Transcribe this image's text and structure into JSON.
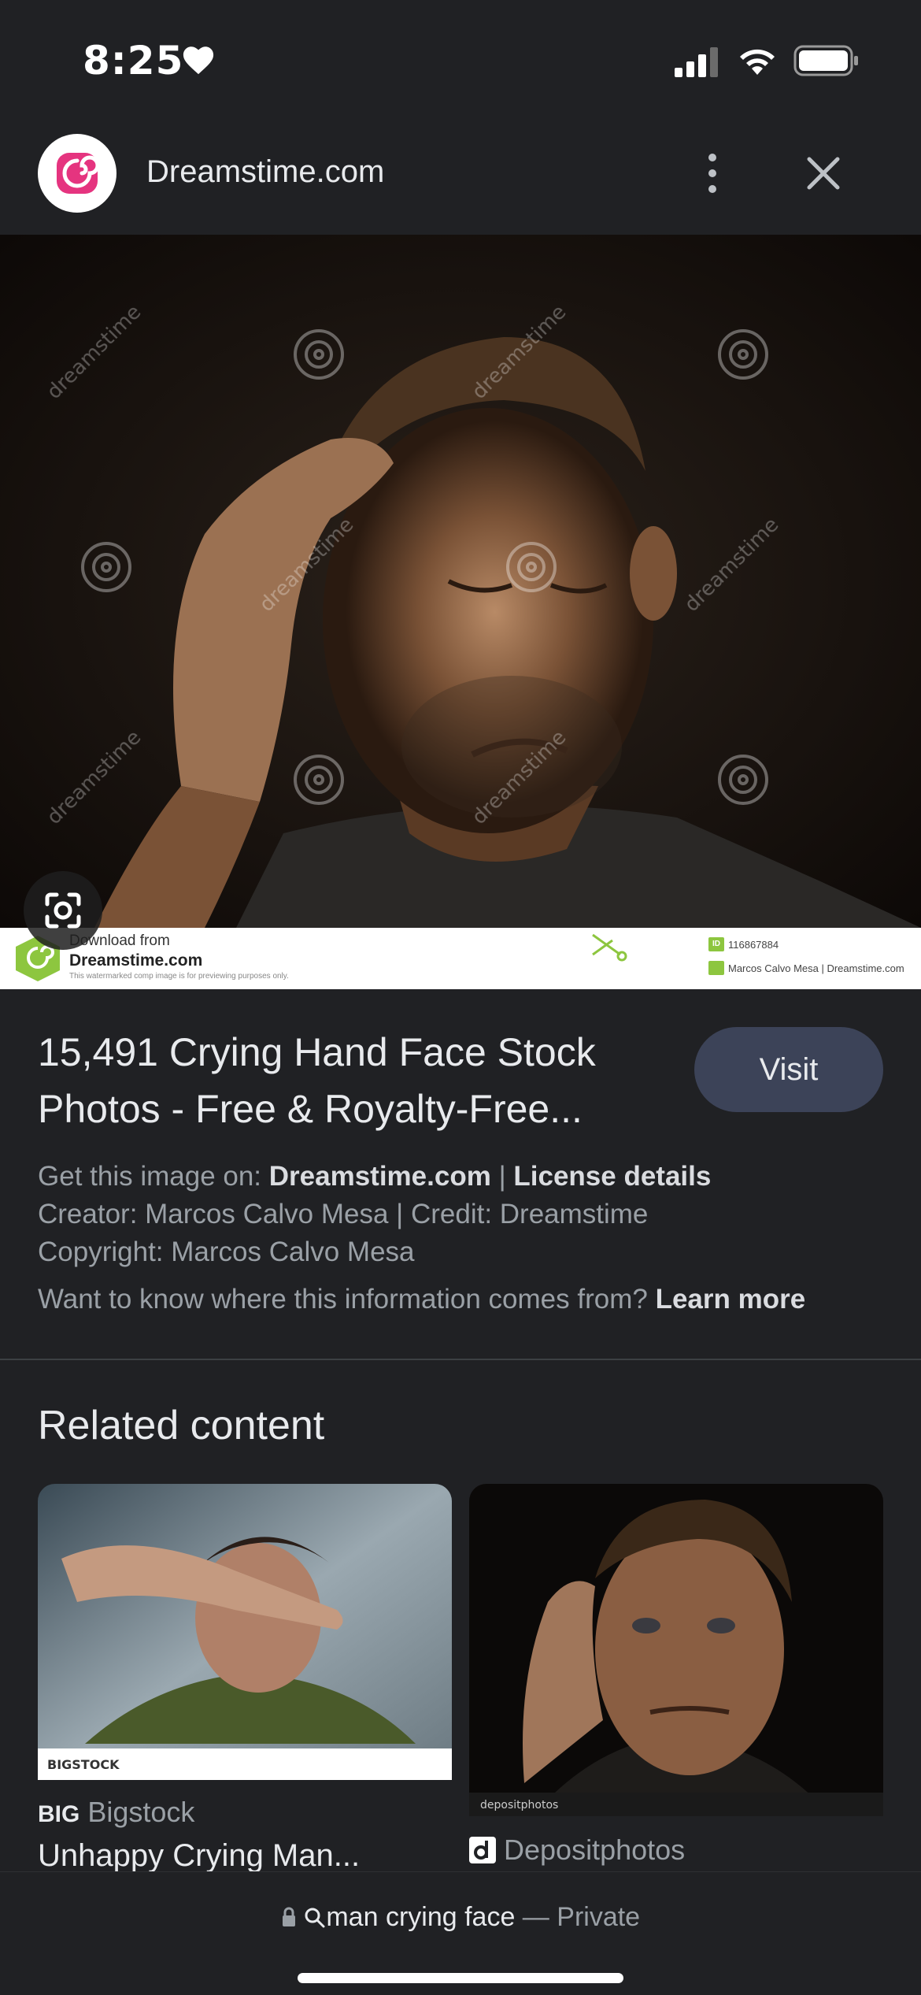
{
  "status_bar": {
    "time": "8:25"
  },
  "header": {
    "site_name": "Dreamstime.com"
  },
  "image": {
    "watermark": "dreamstime",
    "download_from": "Download from",
    "download_site": "Dreamstime.com",
    "download_note": "This watermarked comp image is for previewing purposes only.",
    "id_badge": "ID",
    "image_id": "116867884",
    "credit": "Marcos Calvo Mesa | Dreamstime.com"
  },
  "result": {
    "title_line1": "15,491 Crying Hand Face Stock",
    "title_line2": "Photos - Free & Royalty-Free...",
    "visit_label": "Visit",
    "get_image_prefix": "Get this image on: ",
    "get_image_site": "Dreamstime.com",
    "separator": " | ",
    "license": "License details",
    "creator_line": "Creator: Marcos Calvo Mesa | Credit: Dreamstime",
    "copyright_line": "Copyright: Marcos Calvo Mesa",
    "info_question": "Want to know where this information comes from? ",
    "learn_more": "Learn more"
  },
  "related": {
    "heading": "Related content",
    "items": [
      {
        "source": "Bigstock",
        "source_icon_text": "BIG",
        "title": "Unhappy Crying Man...",
        "watermark": "BIGSTOCK"
      },
      {
        "source": "Depositphotos",
        "watermark": "depositphotos"
      }
    ]
  },
  "bottom": {
    "query": "man crying face",
    "separator": " — ",
    "mode": "Private"
  }
}
